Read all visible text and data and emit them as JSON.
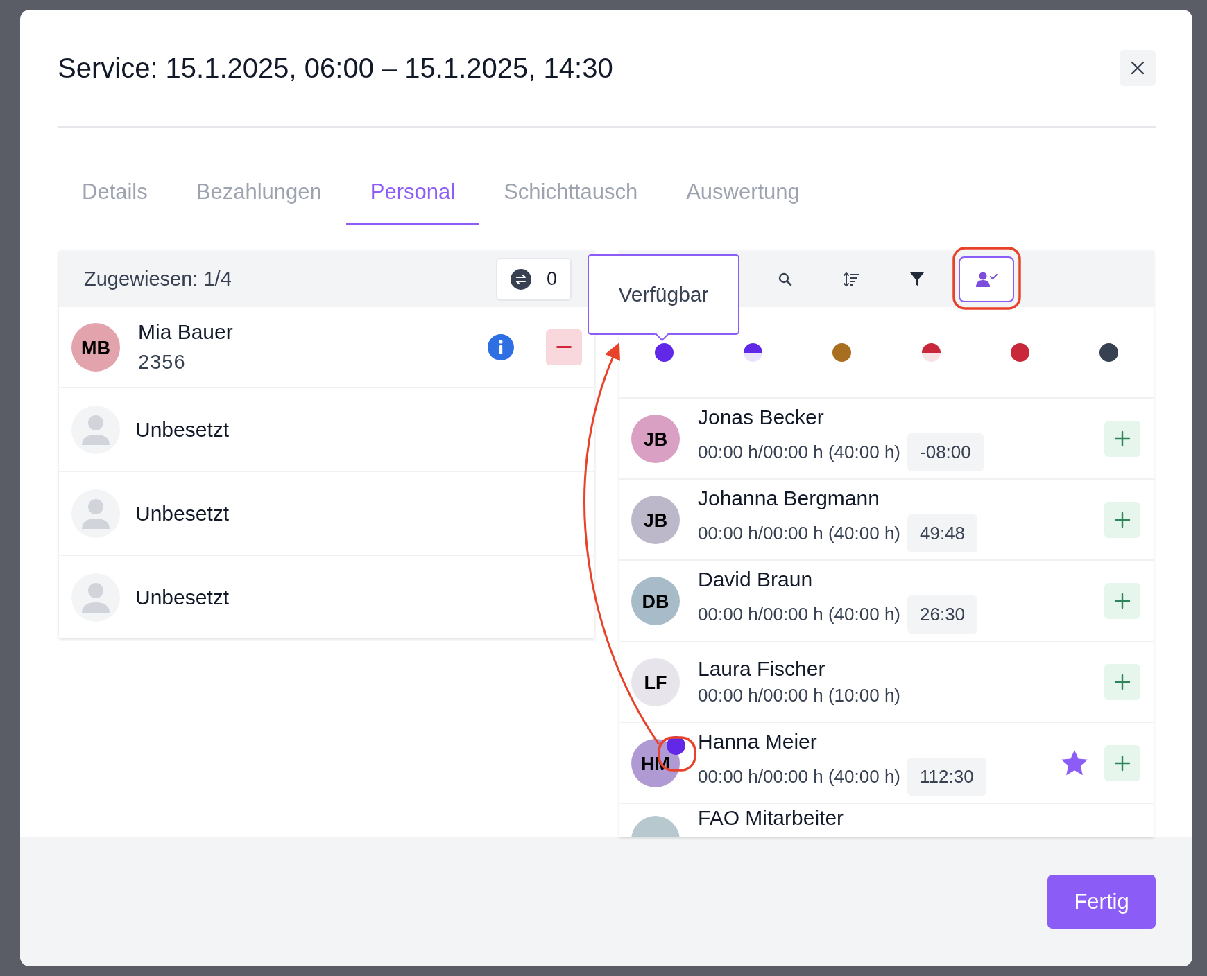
{
  "dialog": {
    "title": "Service: 15.1.2025, 06:00 – 15.1.2025, 14:30"
  },
  "tabs": [
    {
      "label": "Details",
      "selected": false
    },
    {
      "label": "Bezahlungen",
      "selected": false
    },
    {
      "label": "Personal",
      "selected": true
    },
    {
      "label": "Schichttausch",
      "selected": false
    },
    {
      "label": "Auswertung",
      "selected": false
    }
  ],
  "assigned": {
    "title": "Zugewiesen: 1/4",
    "swap_count": "0",
    "slots": [
      {
        "kind": "person",
        "initials": "MB",
        "name": "Mia Bauer",
        "number": "2356",
        "color": "#e3a3ad"
      },
      {
        "kind": "empty",
        "label": "Unbesetzt"
      },
      {
        "kind": "empty",
        "label": "Unbesetzt"
      },
      {
        "kind": "empty",
        "label": "Unbesetzt"
      }
    ]
  },
  "staff": {
    "tooltip": "Verfügbar",
    "toolbar": [
      {
        "kind": "search",
        "selected": false
      },
      {
        "kind": "sort",
        "selected": false
      },
      {
        "kind": "filter",
        "selected": false
      },
      {
        "kind": "available",
        "selected": true
      }
    ],
    "legend": [
      {
        "kind": "full",
        "color": "#6228e8"
      },
      {
        "kind": "half",
        "color": "#6228e8"
      },
      {
        "kind": "full",
        "color": "#a86f20"
      },
      {
        "kind": "half",
        "color": "#c8283a"
      },
      {
        "kind": "full",
        "color": "#c8283a"
      },
      {
        "kind": "full",
        "color": "#374151"
      }
    ],
    "people": [
      {
        "initials": "JB",
        "name": "Jonas Becker",
        "hours": "00:00 h/00:00 h (40:00 h)",
        "balance": "-08:00",
        "color": "#d9a0c4",
        "favorite": false
      },
      {
        "initials": "JB",
        "name": "Johanna Bergmann",
        "hours": "00:00 h/00:00 h (40:00 h)",
        "balance": "49:48",
        "color": "#bcb8c9",
        "favorite": false
      },
      {
        "initials": "DB",
        "name": "David Braun",
        "hours": "00:00 h/00:00 h (40:00 h)",
        "balance": "26:30",
        "color": "#a7bcc8",
        "favorite": false
      },
      {
        "initials": "LF",
        "name": "Laura Fischer",
        "hours": "00:00 h/00:00 h (10:00 h)",
        "color": "#e8e4ec",
        "favorite": false
      },
      {
        "initials": "HM",
        "name": "Hanna Meier",
        "hours": "00:00 h/00:00 h (40:00 h)",
        "balance": "112:30",
        "color": "#b09ad4",
        "favorite": true,
        "status_dot": {
          "color": "#6228e8"
        }
      },
      {
        "name": "FAO Mitarbeiter",
        "color": "#b7c9cf",
        "favorite": false
      }
    ]
  },
  "footer": {
    "done_button": "Fertig"
  }
}
